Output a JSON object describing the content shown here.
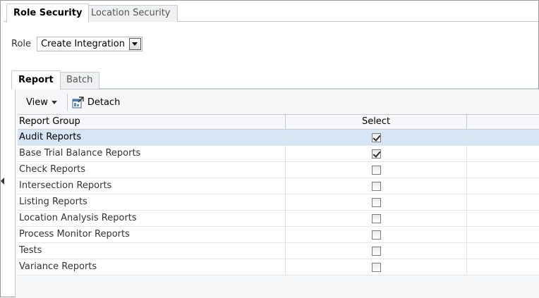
{
  "tabs": [
    {
      "label": "Role Security",
      "active": true
    },
    {
      "label": "Location Security",
      "active": false
    }
  ],
  "role": {
    "label": "Role",
    "selected": "Create Integration"
  },
  "subtabs": [
    {
      "label": "Report",
      "active": true
    },
    {
      "label": "Batch",
      "active": false
    }
  ],
  "toolbar": {
    "view_label": "View",
    "detach_label": "Detach"
  },
  "table": {
    "columns": [
      "Report Group",
      "Select",
      ""
    ],
    "rows": [
      {
        "name": "Audit Reports",
        "checked": true,
        "selected": true
      },
      {
        "name": "Base Trial Balance Reports",
        "checked": true,
        "selected": false
      },
      {
        "name": "Check Reports",
        "checked": false,
        "selected": false
      },
      {
        "name": "Intersection Reports",
        "checked": false,
        "selected": false
      },
      {
        "name": "Listing Reports",
        "checked": false,
        "selected": false
      },
      {
        "name": "Location Analysis Reports",
        "checked": false,
        "selected": false
      },
      {
        "name": "Process Monitor Reports",
        "checked": false,
        "selected": false
      },
      {
        "name": "Tests",
        "checked": false,
        "selected": false
      },
      {
        "name": "Variance Reports",
        "checked": false,
        "selected": false
      }
    ]
  },
  "colors": {
    "selected_row": "#d6e6f5",
    "border": "#c6ccd2",
    "panel_bg": "#f6f7f8"
  }
}
